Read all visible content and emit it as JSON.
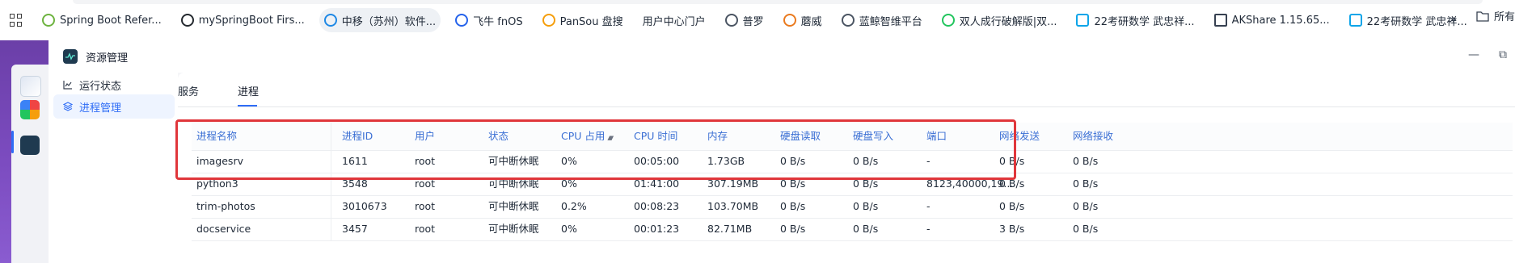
{
  "bookmarks": [
    {
      "label": "Spring Boot Refer...",
      "icon": "spring-leaf-icon",
      "color": "#6db33f"
    },
    {
      "label": "mySpringBoot Firs...",
      "icon": "github-icon",
      "color": "#24292f"
    },
    {
      "label": "中移（苏州）软件...",
      "icon": "cloud-icon",
      "color": "#1e88e5"
    },
    {
      "label": "飞牛 fnOS",
      "icon": "fnos-icon",
      "color": "#2563eb"
    },
    {
      "label": "PanSou 盘搜",
      "icon": "pansou-icon",
      "color": "#f59e0b"
    },
    {
      "label": "用户中心门户",
      "icon": "",
      "color": ""
    },
    {
      "label": "普罗",
      "icon": "globe-icon",
      "color": "#4b5563"
    },
    {
      "label": "蘑威",
      "icon": "location-pin-icon",
      "color": "#ea7a1e"
    },
    {
      "label": "蓝鲸智维平台",
      "icon": "globe-icon",
      "color": "#4b5563"
    },
    {
      "label": "双人成行破解版|双...",
      "icon": "leaf-d-icon",
      "color": "#22c55e"
    },
    {
      "label": "22考研数学 武忠祥...",
      "icon": "bilibili-icon",
      "color": "#0ea5e9"
    },
    {
      "label": "AKShare 1.15.65...",
      "icon": "book-icon",
      "color": "#374151"
    },
    {
      "label": "22考研数学 武忠祥...",
      "icon": "bilibili-icon",
      "color": "#0ea5e9"
    }
  ],
  "bookmarks_overflow": "»",
  "bookmarks_folder": "所有",
  "window": {
    "title": "资源管理",
    "minimize": "—",
    "maximize": "⧉"
  },
  "sidebar": {
    "items": [
      {
        "label": "运行状态",
        "icon": "chart-line-icon",
        "active": false
      },
      {
        "label": "进程管理",
        "icon": "layers-icon",
        "active": true
      }
    ]
  },
  "tabs": [
    {
      "label": "服务",
      "active": false
    },
    {
      "label": "进程",
      "active": true
    }
  ],
  "table": {
    "columns": [
      "进程名称",
      "进程ID",
      "用户",
      "状态",
      "CPU 占用",
      "CPU 时间",
      "内存",
      "硬盘读取",
      "硬盘写入",
      "端口",
      "网络发送",
      "网络接收"
    ],
    "sort_column": "CPU 占用",
    "rows": [
      [
        "imagesrv",
        "1611",
        "root",
        "可中断休眠",
        "0%",
        "00:05:00",
        "1.73GB",
        "0 B/s",
        "0 B/s",
        "-",
        "0 B/s",
        "0 B/s"
      ],
      [
        "python3",
        "3548",
        "root",
        "可中断休眠",
        "0%",
        "01:41:00",
        "307.19MB",
        "0 B/s",
        "0 B/s",
        "8123,40000,19...",
        "0 B/s",
        "0 B/s"
      ],
      [
        "trim-photos",
        "3010673",
        "root",
        "可中断休眠",
        "0.2%",
        "00:08:23",
        "103.70MB",
        "0 B/s",
        "0 B/s",
        "-",
        "0 B/s",
        "0 B/s"
      ],
      [
        "docservice",
        "3457",
        "root",
        "可中断休眠",
        "0%",
        "00:01:23",
        "82.71MB",
        "0 B/s",
        "0 B/s",
        "-",
        "3 B/s",
        "0 B/s"
      ]
    ]
  },
  "colors": {
    "accent": "#2f6df6",
    "highlight": "#e0363b",
    "dock": "#7c4cc0"
  }
}
